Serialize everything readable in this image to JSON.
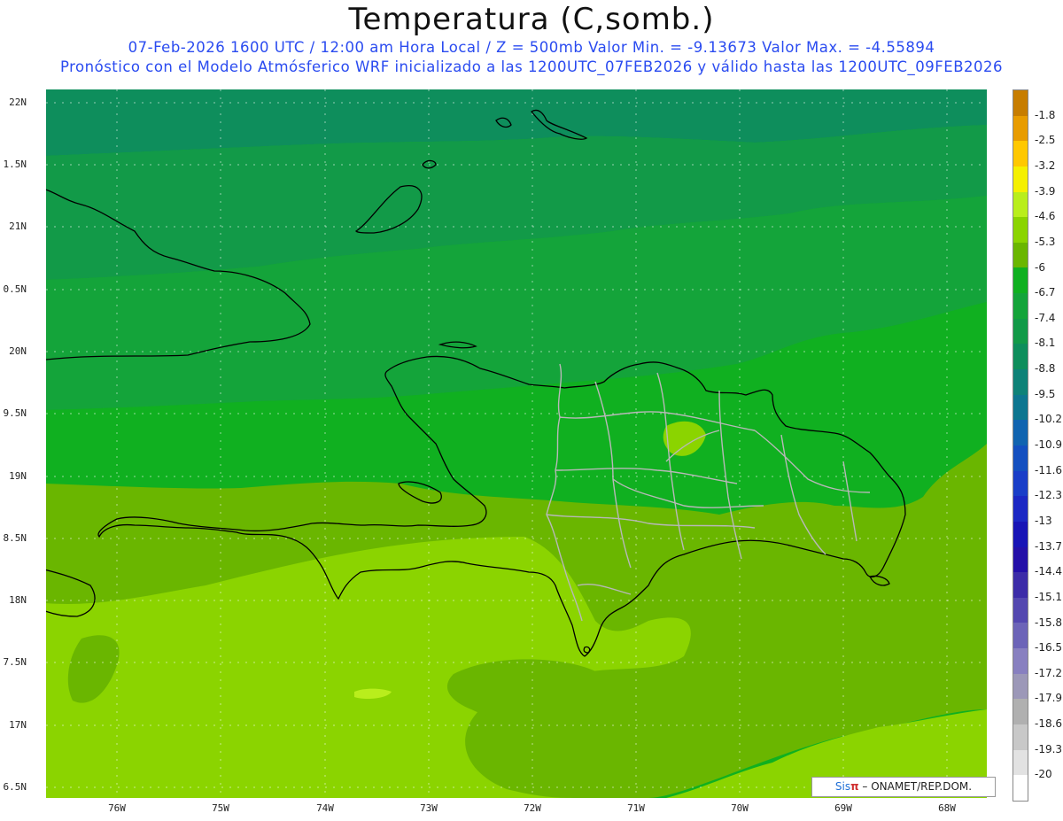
{
  "title": "Temperatura (C,somb.)",
  "subtitle_line1": "07-Feb-2026  1600 UTC / 12:00 am Hora Local / Z = 500mb  Valor Min. = -9.13673  Valor Max. = -4.55894",
  "subtitle_line2": "Pronóstico con el Modelo Atmósferico WRF inicializado a las 1200UTC_07FEB2026 y válido hasta las  1200UTC_09FEB2026",
  "lat_labels": [
    "22N",
    "1.5N",
    "21N",
    "0.5N",
    "20N",
    "9.5N",
    "19N",
    "8.5N",
    "18N",
    "7.5N",
    "17N",
    "6.5N"
  ],
  "lon_labels": [
    "76W",
    "75W",
    "74W",
    "73W",
    "72W",
    "71W",
    "70W",
    "69W",
    "68W"
  ],
  "colorbar": {
    "labels": [
      "-1.8",
      "-2.5",
      "-3.2",
      "-3.9",
      "-4.6",
      "-5.3",
      "-6",
      "-6.7",
      "-7.4",
      "-8.1",
      "-8.8",
      "-9.5",
      "-10.2",
      "-10.9",
      "-11.6",
      "-12.3",
      "-13",
      "-13.7",
      "-14.4",
      "-15.1",
      "-15.8",
      "-16.5",
      "-17.2",
      "-17.9",
      "-18.6",
      "-19.3",
      "-20"
    ],
    "colors": [
      "#c77d00",
      "#e89c00",
      "#ffc800",
      "#f5f000",
      "#b9ee1c",
      "#8bd400",
      "#6ab600",
      "#10b020",
      "#14a43a",
      "#129a48",
      "#0e8e5c",
      "#0e8278",
      "#0d7690",
      "#1164b0",
      "#1450c0",
      "#1a3ec8",
      "#1c28c4",
      "#1814b6",
      "#2410a8",
      "#3c2ca8",
      "#5448b0",
      "#6c64b8",
      "#8880c0",
      "#9c98b8",
      "#b0b0b0",
      "#c8c8c8",
      "#e2e2e2",
      "#ffffff"
    ]
  },
  "credit": {
    "brand": "Sis",
    "pi": "π",
    "text": " – ONAMET/REP.DOM."
  }
}
